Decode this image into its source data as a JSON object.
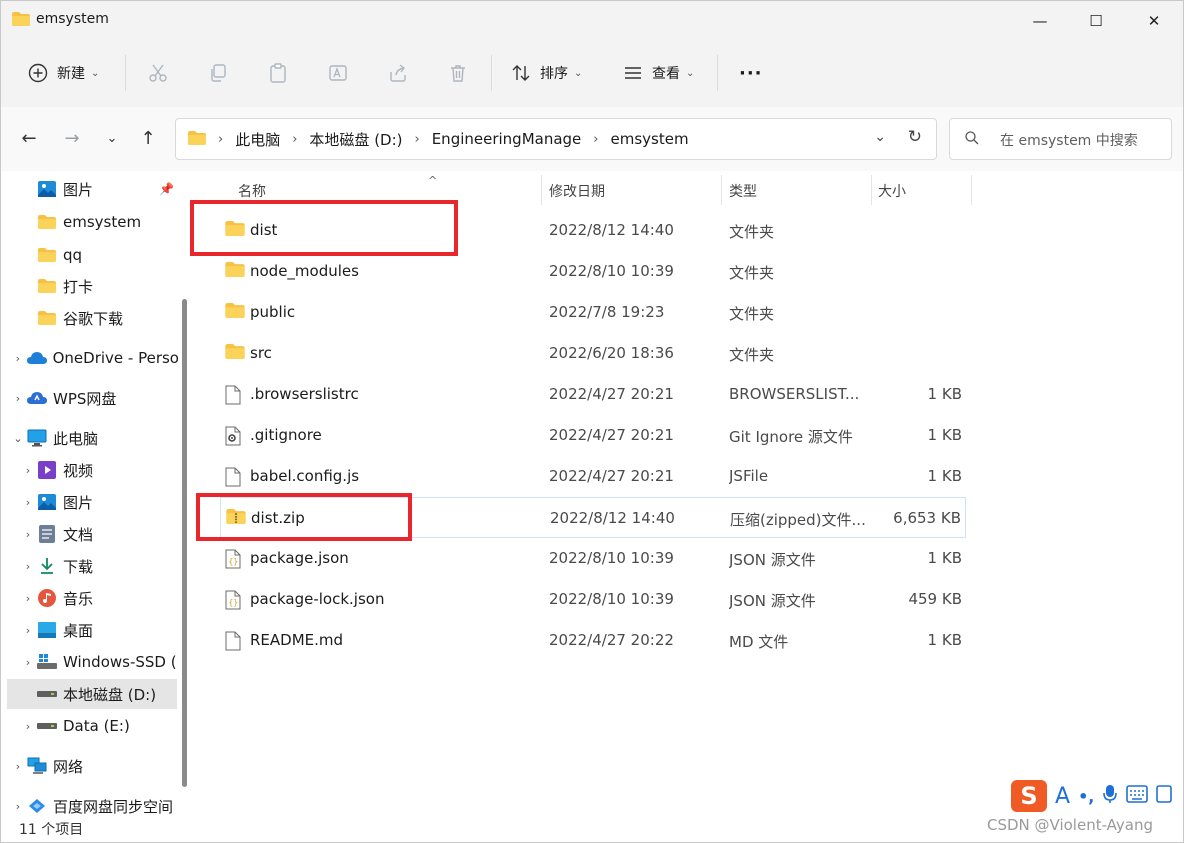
{
  "window": {
    "title": "emsystem",
    "minimize": "—",
    "maximize": "☐",
    "close": "✕"
  },
  "toolbar": {
    "new_label": "新建",
    "sort_label": "排序",
    "view_label": "查看",
    "more_label": "···"
  },
  "address": {
    "crumbs": [
      "此电脑",
      "本地磁盘 (D:)",
      "EngineeringManage",
      "emsystem"
    ],
    "search_placeholder": "在 emsystem 中搜索"
  },
  "sidebar": {
    "quick": [
      {
        "label": "图片",
        "icon": "pictures-icon"
      },
      {
        "label": "emsystem",
        "icon": "folder-icon"
      },
      {
        "label": "qq",
        "icon": "folder-icon"
      },
      {
        "label": "打卡",
        "icon": "folder-icon"
      },
      {
        "label": "谷歌下载",
        "icon": "folder-icon"
      }
    ],
    "onedrive": "OneDrive - Perso",
    "wps": "WPS网盘",
    "thispc": "此电脑",
    "pc_items": [
      {
        "label": "视频",
        "icon": "video-icon"
      },
      {
        "label": "图片",
        "icon": "pictures-icon"
      },
      {
        "label": "文档",
        "icon": "documents-icon"
      },
      {
        "label": "下载",
        "icon": "download-icon"
      },
      {
        "label": "音乐",
        "icon": "music-icon"
      },
      {
        "label": "桌面",
        "icon": "desktop-icon"
      },
      {
        "label": "Windows-SSD (",
        "icon": "windows-drive-icon"
      },
      {
        "label": "本地磁盘 (D:)",
        "icon": "drive-icon"
      },
      {
        "label": "Data (E:)",
        "icon": "drive-icon"
      }
    ],
    "network": "网络",
    "baidu": "百度网盘同步空间"
  },
  "columns": {
    "name": "名称",
    "date": "修改日期",
    "type": "类型",
    "size": "大小"
  },
  "files": [
    {
      "name": "dist",
      "date": "2022/8/12 14:40",
      "type": "文件夹",
      "size": "",
      "icon": "folder-icon"
    },
    {
      "name": "node_modules",
      "date": "2022/8/10 10:39",
      "type": "文件夹",
      "size": "",
      "icon": "folder-icon"
    },
    {
      "name": "public",
      "date": "2022/7/8 19:23",
      "type": "文件夹",
      "size": "",
      "icon": "folder-icon"
    },
    {
      "name": "src",
      "date": "2022/6/20 18:36",
      "type": "文件夹",
      "size": "",
      "icon": "folder-icon"
    },
    {
      "name": ".browserslistrc",
      "date": "2022/4/27 20:21",
      "type": "BROWSERSLIST...",
      "size": "1 KB",
      "icon": "file-icon"
    },
    {
      "name": ".gitignore",
      "date": "2022/4/27 20:21",
      "type": "Git Ignore 源文件",
      "size": "1 KB",
      "icon": "gear-file-icon"
    },
    {
      "name": "babel.config.js",
      "date": "2022/4/27 20:21",
      "type": "JSFile",
      "size": "1 KB",
      "icon": "file-icon"
    },
    {
      "name": "dist.zip",
      "date": "2022/8/12 14:40",
      "type": "压缩(zipped)文件...",
      "size": "6,653 KB",
      "icon": "zip-folder-icon"
    },
    {
      "name": "package.json",
      "date": "2022/8/10 10:39",
      "type": "JSON 源文件",
      "size": "1 KB",
      "icon": "json-file-icon"
    },
    {
      "name": "package-lock.json",
      "date": "2022/8/10 10:39",
      "type": "JSON 源文件",
      "size": "459 KB",
      "icon": "json-file-icon"
    },
    {
      "name": "README.md",
      "date": "2022/4/27 20:22",
      "type": "MD 文件",
      "size": "1 KB",
      "icon": "file-icon"
    }
  ],
  "status": {
    "item_count": "11 个项目"
  },
  "ime": {
    "logo": "S",
    "letter": "A",
    "punct": "•,"
  },
  "watermark": "CSDN @Violent-Ayang",
  "colors": {
    "highlight": "#e8262b",
    "folder": "#f7c244",
    "accent": "#0067c0"
  }
}
